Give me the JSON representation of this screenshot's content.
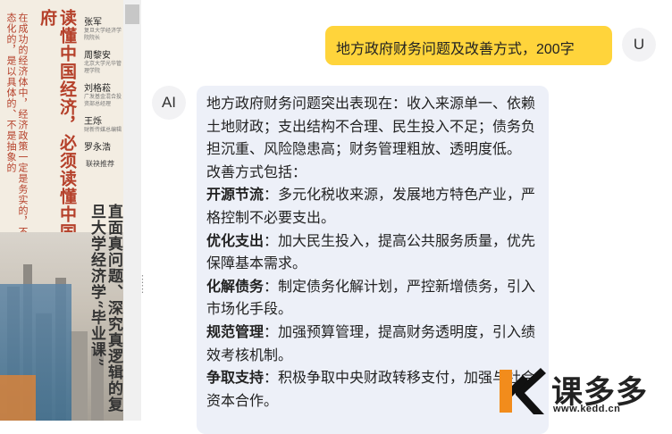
{
  "cover": {
    "subtitle": "在成功的经济体中，经济政策一定是务实的，不是意识形态化的，是以具体的、不是抽象的",
    "title": "读懂中国经济，必须读懂中国政府",
    "authors": [
      {
        "name": "张军",
        "affiliation": "复旦大学经济学院院长"
      },
      {
        "name": "周黎安",
        "affiliation": "北京大学光华管理学院"
      },
      {
        "name": "刘格菘",
        "affiliation": "广发基金混合投资部总经理"
      },
      {
        "name": "王烁",
        "affiliation": "财新传媒总编辑"
      },
      {
        "name": "罗永浩",
        "affiliation": ""
      }
    ],
    "recommend": "联袂推荐",
    "big_title": "直面真问题、深究真逻辑的复旦大学经济学“毕业课”"
  },
  "chat": {
    "user_avatar": "U",
    "user_message": "地方政府财务问题及改善方式，200字",
    "ai_avatar": "AI",
    "ai_intro": "地方政府财务问题突出表现在：收入来源单一、依赖土地财政；支出结构不合理、民生投入不足；债务负担沉重、风险隐患高；财务管理粗放、透明度低。",
    "ai_methods_label": "改善方式包括：",
    "ai_items": [
      {
        "head": "开源节流",
        "body": "：多元化税收来源，发展地方特色产业，严格控制不必要支出。"
      },
      {
        "head": "优化支出",
        "body": "：加大民生投入，提高公共服务质量，优先保障基本需求。"
      },
      {
        "head": "化解债务",
        "body": "：制定债务化解计划，严控新增债务，引入市场化手段。"
      },
      {
        "head": "规范管理",
        "body": "：加强预算管理，提高财务透明度，引入绩效考核机制。"
      },
      {
        "head": "争取支持",
        "body": "：积极争取中央财政转移支付，加强与社会资本合作。"
      }
    ]
  },
  "watermark": {
    "name": "课多多",
    "url": "www.kedd.cn",
    "accent": "#f28c1c"
  }
}
